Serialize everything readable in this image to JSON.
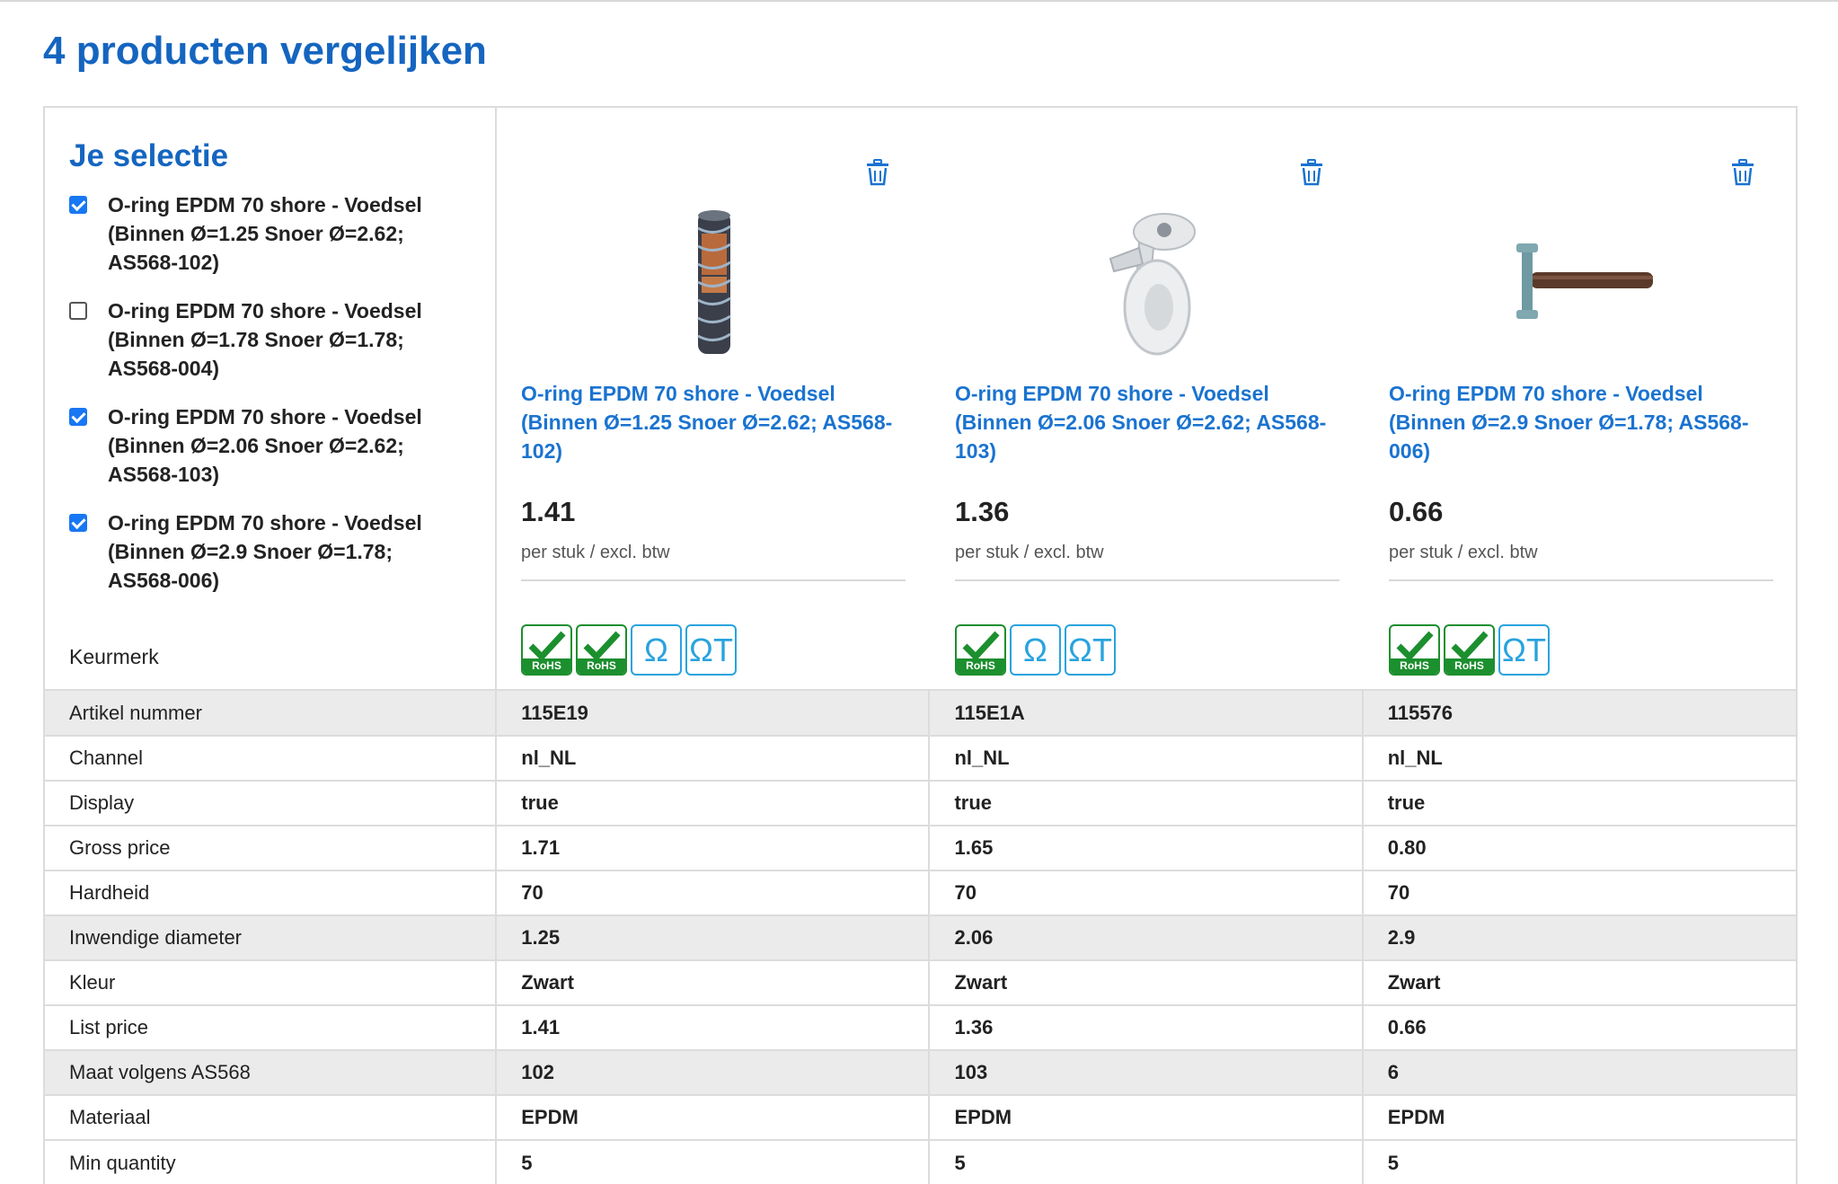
{
  "page": {
    "title": "4 producten vergelijken"
  },
  "selection": {
    "title": "Je selectie",
    "items": [
      {
        "label": "O-ring EPDM 70 shore - Voedsel (Binnen Ø=1.25 Snoer Ø=2.62; AS568-102)",
        "checked": true
      },
      {
        "label": "O-ring EPDM 70 shore - Voedsel (Binnen Ø=1.78 Snoer Ø=1.78; AS568-004)",
        "checked": false
      },
      {
        "label": "O-ring EPDM 70 shore - Voedsel (Binnen Ø=2.06 Snoer Ø=2.62; AS568-103)",
        "checked": true
      },
      {
        "label": "O-ring EPDM 70 shore - Voedsel (Binnen Ø=2.9 Snoer Ø=1.78; AS568-006)",
        "checked": true
      }
    ],
    "keurmerk_label": "Keurmerk"
  },
  "products": [
    {
      "name": "O-ring EPDM 70 shore - Voedsel (Binnen Ø=1.25 Snoer Ø=2.62; AS568-102)",
      "price": "1.41",
      "price_note": "per stuk / excl. btw",
      "image": "spiral-hose",
      "marks": [
        "rohs",
        "rohs",
        "omega",
        "omega-t"
      ]
    },
    {
      "name": "O-ring EPDM 70 shore - Voedsel (Binnen Ø=2.06 Snoer Ø=2.62; AS568-103)",
      "price": "1.36",
      "price_note": "per stuk / excl. btw",
      "image": "castor-wheel",
      "marks": [
        "rohs",
        "omega",
        "omega-t"
      ]
    },
    {
      "name": "O-ring EPDM 70 shore - Voedsel (Binnen Ø=2.9 Snoer Ø=1.78; AS568- 006)",
      "price": "0.66",
      "price_note": "per stuk / excl. btw",
      "image": "hammer",
      "marks": [
        "rohs",
        "rohs",
        "omega-t"
      ]
    }
  ],
  "marks_text": {
    "rohs": "RoHS",
    "omega": "Ω",
    "omega_t": "ΩT"
  },
  "colors": {
    "accent": "#1565c0",
    "link": "#1a73d0",
    "rohs_green": "#1c8f2e",
    "omega_blue": "#29a3de"
  },
  "specs": [
    {
      "label": "Artikel nummer",
      "values": [
        "115E19",
        "115E1A",
        "115576"
      ],
      "shaded": true
    },
    {
      "label": "Channel",
      "values": [
        "nl_NL",
        "nl_NL",
        "nl_NL"
      ],
      "shaded": false
    },
    {
      "label": "Display",
      "values": [
        "true",
        "true",
        "true"
      ],
      "shaded": false
    },
    {
      "label": "Gross price",
      "values": [
        "1.71",
        "1.65",
        "0.80"
      ],
      "shaded": false
    },
    {
      "label": "Hardheid",
      "values": [
        "70",
        "70",
        "70"
      ],
      "shaded": false
    },
    {
      "label": "Inwendige diameter",
      "values": [
        "1.25",
        "2.06",
        "2.9"
      ],
      "shaded": true
    },
    {
      "label": "Kleur",
      "values": [
        "Zwart",
        "Zwart",
        "Zwart"
      ],
      "shaded": false
    },
    {
      "label": "List price",
      "values": [
        "1.41",
        "1.36",
        "0.66"
      ],
      "shaded": false
    },
    {
      "label": "Maat volgens AS568",
      "values": [
        "102",
        "103",
        "6"
      ],
      "shaded": true
    },
    {
      "label": "Materiaal",
      "values": [
        "EPDM",
        "EPDM",
        "EPDM"
      ],
      "shaded": false
    },
    {
      "label": "Min quantity",
      "values": [
        "5",
        "5",
        "5"
      ],
      "shaded": false
    }
  ]
}
